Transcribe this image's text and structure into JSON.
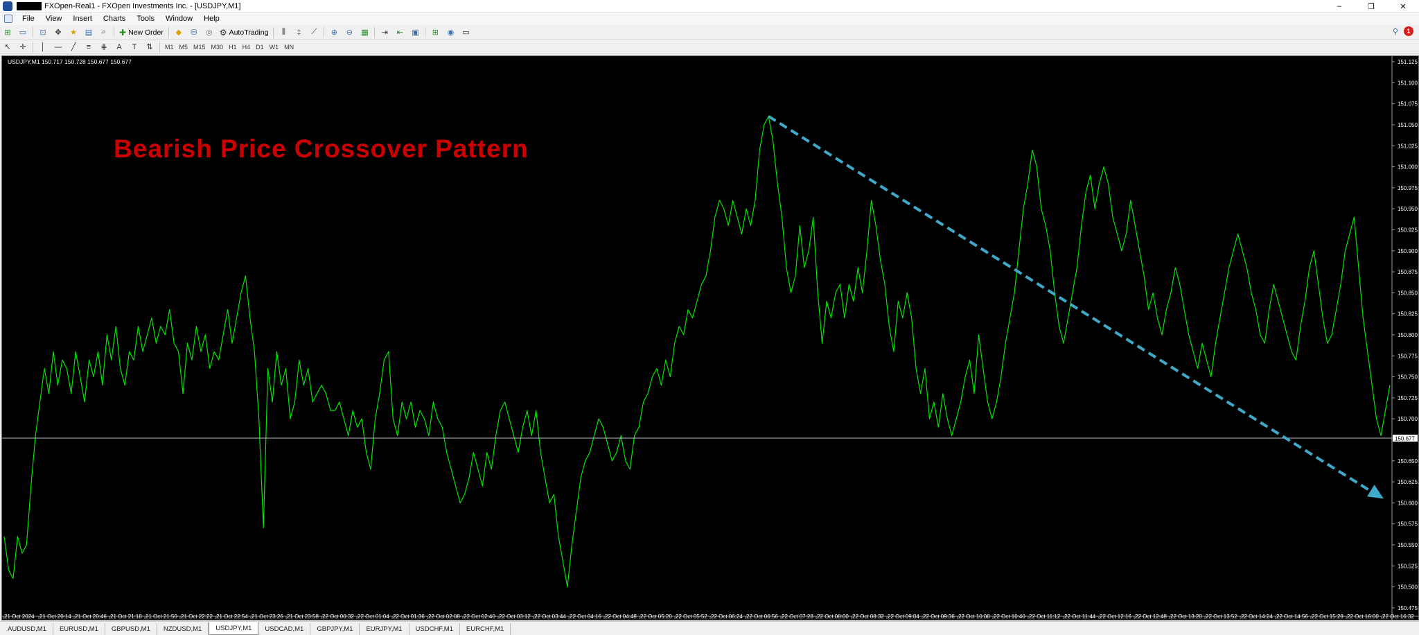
{
  "window": {
    "title": "FXOpen-Real1 - FXOpen Investments Inc. - [USDJPY,M1]",
    "controls": [
      "–",
      "❐",
      "✕"
    ]
  },
  "menu": [
    "File",
    "View",
    "Insert",
    "Charts",
    "Tools",
    "Window",
    "Help"
  ],
  "toolbar": {
    "new_order": "New Order",
    "autotrading": "AutoTrading",
    "timeframes": [
      "M1",
      "M5",
      "M15",
      "M30",
      "H1",
      "H4",
      "D1",
      "W1",
      "MN"
    ]
  },
  "chart": {
    "info": "USDJPY,M1  150.717 150.728 150.677 150.677",
    "headline": "Bearish Price Crossover Pattern",
    "current_price_label": "150.677",
    "colors": {
      "price_line": "#00e600",
      "trend_arrow": "#3fa9c9",
      "headline": "#cc0000",
      "background": "#000000"
    }
  },
  "chart_data": {
    "type": "line",
    "symbol": "USDJPY",
    "timeframe": "M1",
    "ylim": [
      150.465,
      151.13
    ],
    "y_ticks": [
      "151.125",
      "151.100",
      "151.075",
      "151.050",
      "151.025",
      "151.000",
      "150.975",
      "150.950",
      "150.925",
      "150.900",
      "150.875",
      "150.850",
      "150.825",
      "150.800",
      "150.775",
      "150.750",
      "150.725",
      "150.700",
      "150.677",
      "150.650",
      "150.625",
      "150.600",
      "150.575",
      "150.550",
      "150.525",
      "150.500",
      "150.475"
    ],
    "x_ticks": [
      "21 Oct 2024",
      "21 Oct 20:14",
      "21 Oct 20:46",
      "21 Oct 21:18",
      "21 Oct 21:50",
      "21 Oct 22:22",
      "21 Oct 22:54",
      "21 Oct 23:26",
      "21 Oct 23:58",
      "22 Oct 00:32",
      "22 Oct 01:04",
      "22 Oct 01:36",
      "22 Oct 02:08",
      "22 Oct 02:40",
      "22 Oct 03:12",
      "22 Oct 03:44",
      "22 Oct 04:16",
      "22 Oct 04:48",
      "22 Oct 05:20",
      "22 Oct 05:52",
      "22 Oct 06:24",
      "22 Oct 06:56",
      "22 Oct 07:28",
      "22 Oct 08:00",
      "22 Oct 08:32",
      "22 Oct 09:04",
      "22 Oct 09:36",
      "22 Oct 10:08",
      "22 Oct 10:40",
      "22 Oct 11:12",
      "22 Oct 11:44",
      "22 Oct 12:16",
      "22 Oct 12:48",
      "22 Oct 13:20",
      "22 Oct 13:52",
      "22 Oct 14:24",
      "22 Oct 14:56",
      "22 Oct 15:28",
      "22 Oct 16:00",
      "22 Oct 16:32"
    ],
    "price_level": 150.677,
    "series": [
      {
        "values": [
          150.56,
          150.52,
          150.51,
          150.56,
          150.54,
          150.55,
          150.62,
          150.68,
          150.72,
          150.76,
          150.73,
          150.78,
          150.74,
          150.77,
          150.76,
          150.73,
          150.78,
          150.75,
          150.72,
          150.77,
          150.75,
          150.78,
          150.74,
          150.8,
          150.77,
          150.81,
          150.76,
          150.74,
          150.78,
          150.77,
          150.81,
          150.78,
          150.8,
          150.82,
          150.79,
          150.81,
          150.8,
          150.83,
          150.79,
          150.78,
          150.73,
          150.79,
          150.77,
          150.81,
          150.78,
          150.8,
          150.76,
          150.78,
          150.77,
          150.8,
          150.83,
          150.79,
          150.82,
          150.85,
          150.87,
          150.82,
          150.78,
          150.7,
          150.57,
          150.76,
          150.72,
          150.78,
          150.74,
          150.76,
          150.7,
          150.72,
          150.77,
          150.74,
          150.76,
          150.72,
          150.73,
          150.74,
          150.73,
          150.71,
          150.71,
          150.72,
          150.7,
          150.68,
          150.71,
          150.69,
          150.7,
          150.66,
          150.64,
          150.7,
          150.73,
          150.77,
          150.78,
          150.7,
          150.68,
          150.72,
          150.7,
          150.72,
          150.69,
          150.71,
          150.7,
          150.68,
          150.72,
          150.7,
          150.69,
          150.66,
          150.64,
          150.62,
          150.6,
          150.61,
          150.63,
          150.66,
          150.64,
          150.62,
          150.66,
          150.64,
          150.68,
          150.71,
          150.72,
          150.7,
          150.68,
          150.66,
          150.69,
          150.71,
          150.68,
          150.71,
          150.66,
          150.63,
          150.6,
          150.61,
          150.56,
          150.53,
          150.5,
          150.55,
          150.59,
          150.63,
          150.65,
          150.66,
          150.68,
          150.7,
          150.69,
          150.67,
          150.65,
          150.66,
          150.68,
          150.65,
          150.64,
          150.68,
          150.69,
          150.72,
          150.73,
          150.75,
          150.76,
          150.74,
          150.77,
          150.75,
          150.79,
          150.81,
          150.8,
          150.83,
          150.82,
          150.84,
          150.86,
          150.87,
          150.9,
          150.94,
          150.96,
          150.95,
          150.93,
          150.96,
          150.94,
          150.92,
          150.95,
          150.93,
          150.96,
          151.02,
          151.05,
          151.06,
          151.03,
          150.98,
          150.94,
          150.88,
          150.85,
          150.87,
          150.93,
          150.88,
          150.9,
          150.94,
          150.85,
          150.79,
          150.84,
          150.82,
          150.85,
          150.86,
          150.82,
          150.86,
          150.84,
          150.88,
          150.85,
          150.9,
          150.96,
          150.93,
          150.89,
          150.86,
          150.81,
          150.78,
          150.84,
          150.82,
          150.85,
          150.82,
          150.76,
          150.73,
          150.76,
          150.7,
          150.72,
          150.69,
          150.73,
          150.7,
          150.68,
          150.7,
          150.72,
          150.75,
          150.77,
          150.73,
          150.8,
          150.76,
          150.72,
          150.7,
          150.72,
          150.75,
          150.79,
          150.82,
          150.85,
          150.9,
          150.95,
          150.98,
          151.02,
          151.0,
          150.95,
          150.93,
          150.9,
          150.85,
          150.81,
          150.79,
          150.82,
          150.85,
          150.88,
          150.93,
          150.97,
          150.99,
          150.95,
          150.98,
          151.0,
          150.98,
          150.94,
          150.92,
          150.9,
          150.92,
          150.96,
          150.93,
          150.9,
          150.87,
          150.83,
          150.85,
          150.82,
          150.8,
          150.83,
          150.85,
          150.88,
          150.86,
          150.83,
          150.8,
          150.78,
          150.76,
          150.79,
          150.77,
          150.75,
          150.79,
          150.82,
          150.85,
          150.88,
          150.9,
          150.92,
          150.9,
          150.88,
          150.85,
          150.83,
          150.8,
          150.79,
          150.83,
          150.86,
          150.84,
          150.82,
          150.8,
          150.78,
          150.77,
          150.81,
          150.84,
          150.88,
          150.9,
          150.86,
          150.82,
          150.79,
          150.8,
          150.83,
          150.86,
          150.9,
          150.92,
          150.94,
          150.88,
          150.82,
          150.78,
          150.74,
          150.7,
          150.68,
          150.71,
          150.74
        ]
      }
    ]
  },
  "tabs": [
    "AUDUSD,M1",
    "EURUSD,M1",
    "GBPUSD,M1",
    "NZDUSD,M1",
    "USDJPY,M1",
    "USDCAD,M1",
    "GBPJPY,M1",
    "EURJPY,M1",
    "USDCHF,M1",
    "EURCHF,M1"
  ],
  "active_tab": "USDJPY,M1"
}
